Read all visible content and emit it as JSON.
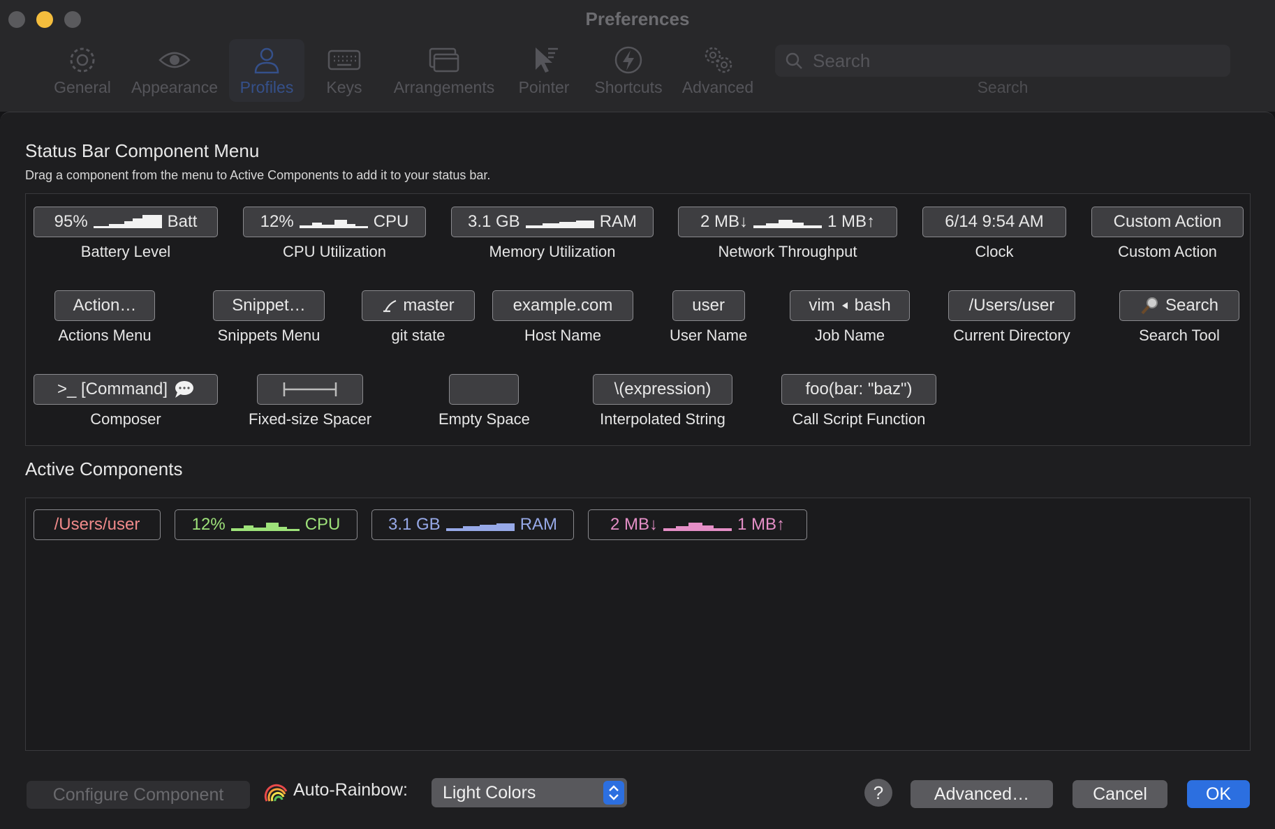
{
  "window": {
    "title": "Preferences"
  },
  "tabs": [
    {
      "label": "General",
      "icon": "gear-icon"
    },
    {
      "label": "Appearance",
      "icon": "eye-icon"
    },
    {
      "label": "Profiles",
      "icon": "person-icon",
      "active": true
    },
    {
      "label": "Keys",
      "icon": "keyboard-icon"
    },
    {
      "label": "Arrangements",
      "icon": "windows-icon"
    },
    {
      "label": "Pointer",
      "icon": "pointer-icon"
    },
    {
      "label": "Shortcuts",
      "icon": "bolt-icon"
    },
    {
      "label": "Advanced",
      "icon": "gears-icon"
    }
  ],
  "search": {
    "placeholder": "Search",
    "label": "Search"
  },
  "menu_section": {
    "title": "Status Bar Component Menu",
    "description": "Drag a component from the menu to Active Components to add it to your status bar."
  },
  "components": {
    "battery": {
      "pre": "95%",
      "post": "Batt",
      "label": "Battery Level"
    },
    "cpu": {
      "pre": "12%",
      "post": "CPU",
      "label": "CPU Utilization"
    },
    "memory": {
      "pre": "3.1 GB",
      "post": "RAM",
      "label": "Memory Utilization"
    },
    "network": {
      "pre": "2 MB↓",
      "post": "1 MB↑",
      "label": "Network Throughput"
    },
    "clock": {
      "chip": "6/14 9:54 AM",
      "label": "Clock"
    },
    "custom_action": {
      "chip": "Custom Action",
      "label": "Custom Action"
    },
    "actions": {
      "chip": "Action…",
      "label": "Actions Menu"
    },
    "snippets": {
      "chip": "Snippet…",
      "label": "Snippets Menu"
    },
    "git": {
      "chip": "master",
      "label": "git state"
    },
    "host": {
      "chip": "example.com",
      "label": "Host Name"
    },
    "user": {
      "chip": "user",
      "label": "User Name"
    },
    "job": {
      "pre": "vim",
      "post": "bash",
      "label": "Job Name"
    },
    "directory": {
      "chip": "/Users/user",
      "label": "Current Directory"
    },
    "search_tool": {
      "chip": "Search",
      "label": "Search Tool"
    },
    "composer": {
      "chip": ">_ [Command]",
      "label": "Composer"
    },
    "fixed_spacer": {
      "label": "Fixed-size Spacer"
    },
    "empty_space": {
      "label": "Empty Space"
    },
    "interpolated": {
      "chip": "\\(expression)",
      "label": "Interpolated String"
    },
    "call_script": {
      "chip": "foo(bar: \"baz\")",
      "label": "Call Script Function"
    }
  },
  "active_section": {
    "title": "Active Components",
    "items": {
      "directory": {
        "text": "/Users/user",
        "color": "#f08a8a"
      },
      "cpu": {
        "pre": "12%",
        "post": "CPU",
        "color": "#9ee27a"
      },
      "memory": {
        "pre": "3.1 GB",
        "post": "RAM",
        "color": "#97a9e8"
      },
      "network": {
        "pre": "2 MB↓",
        "post": "1 MB↑",
        "color": "#e58fc7"
      }
    }
  },
  "footer": {
    "configure": "Configure Component",
    "rainbow_label": "Auto-Rainbow:",
    "rainbow_value": "Light Colors",
    "help": "?",
    "advanced": "Advanced…",
    "cancel": "Cancel",
    "ok": "OK"
  },
  "colors": {
    "accent": "#2c6fe0",
    "traffic_yellow": "#f4bd3d"
  }
}
